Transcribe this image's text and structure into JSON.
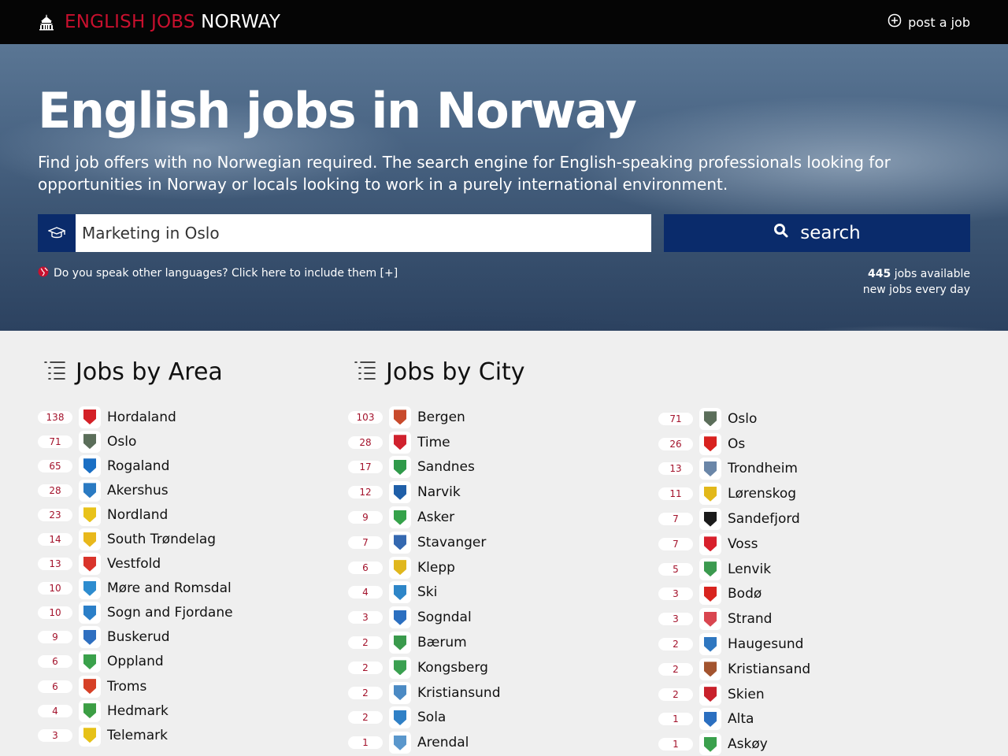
{
  "header": {
    "brand_part1": "ENGLISH JOBS",
    "brand_part2": "NORWAY",
    "post_job_label": "post a job"
  },
  "hero": {
    "title": "English jobs in Norway",
    "lead": "Find job offers with no Norwegian required. The search engine for English-speaking professionals looking for opportunities in Norway or locals looking to work in a purely international environment.",
    "search_value": "Marketing in Oslo",
    "search_button": "search",
    "languages_link": "Do you speak other languages? Click here to include them [+]",
    "jobs_count": "445",
    "jobs_available": "jobs available",
    "new_jobs": "new jobs every day"
  },
  "areas": {
    "title": "Jobs by Area",
    "items": [
      {
        "count": "138",
        "label": "Hordaland",
        "color": "#d42027"
      },
      {
        "count": "71",
        "label": "Oslo",
        "color": "#5b6e5a"
      },
      {
        "count": "65",
        "label": "Rogaland",
        "color": "#1a6fc4"
      },
      {
        "count": "28",
        "label": "Akershus",
        "color": "#2a7ac2"
      },
      {
        "count": "23",
        "label": "Nordland",
        "color": "#e8c21a"
      },
      {
        "count": "14",
        "label": "South Trøndelag",
        "color": "#e8b81c"
      },
      {
        "count": "13",
        "label": "Vestfold",
        "color": "#d9342b"
      },
      {
        "count": "10",
        "label": "Møre and Romsdal",
        "color": "#2d8ccf"
      },
      {
        "count": "10",
        "label": "Sogn and Fjordane",
        "color": "#2b7fc8"
      },
      {
        "count": "9",
        "label": "Buskerud",
        "color": "#2e6fc0"
      },
      {
        "count": "6",
        "label": "Oppland",
        "color": "#3aa14b"
      },
      {
        "count": "6",
        "label": "Troms",
        "color": "#d64027"
      },
      {
        "count": "4",
        "label": "Hedmark",
        "color": "#3c9e44"
      },
      {
        "count": "3",
        "label": "Telemark",
        "color": "#e6c117"
      }
    ]
  },
  "cities": {
    "title": "Jobs by City",
    "col1": [
      {
        "count": "103",
        "label": "Bergen",
        "color": "#c84a2c"
      },
      {
        "count": "28",
        "label": "Time",
        "color": "#d0222e"
      },
      {
        "count": "17",
        "label": "Sandnes",
        "color": "#2f9a4a"
      },
      {
        "count": "12",
        "label": "Narvik",
        "color": "#1f5fa8"
      },
      {
        "count": "9",
        "label": "Asker",
        "color": "#35a24a"
      },
      {
        "count": "7",
        "label": "Stavanger",
        "color": "#3468b0"
      },
      {
        "count": "6",
        "label": "Klepp",
        "color": "#e0b71d"
      },
      {
        "count": "4",
        "label": "Ski",
        "color": "#2e86c8"
      },
      {
        "count": "3",
        "label": "Sogndal",
        "color": "#2b6fc0"
      },
      {
        "count": "2",
        "label": "Bærum",
        "color": "#3a9a4c"
      },
      {
        "count": "2",
        "label": "Kongsberg",
        "color": "#3aa050"
      },
      {
        "count": "2",
        "label": "Kristiansund",
        "color": "#4b8ac4"
      },
      {
        "count": "2",
        "label": "Sola",
        "color": "#2f80c6"
      },
      {
        "count": "1",
        "label": "Arendal",
        "color": "#5a97cc"
      }
    ],
    "col2": [
      {
        "count": "71",
        "label": "Oslo",
        "color": "#5b6e5a"
      },
      {
        "count": "26",
        "label": "Os",
        "color": "#d8221f"
      },
      {
        "count": "13",
        "label": "Trondheim",
        "color": "#6a86a8"
      },
      {
        "count": "11",
        "label": "Lørenskog",
        "color": "#e2b81a"
      },
      {
        "count": "7",
        "label": "Sandefjord",
        "color": "#1b1b1b"
      },
      {
        "count": "7",
        "label": "Voss",
        "color": "#d8202c"
      },
      {
        "count": "5",
        "label": "Lenvik",
        "color": "#3b9a4f"
      },
      {
        "count": "3",
        "label": "Bodø",
        "color": "#d8241f"
      },
      {
        "count": "3",
        "label": "Strand",
        "color": "#d94650"
      },
      {
        "count": "2",
        "label": "Haugesund",
        "color": "#2f77c0"
      },
      {
        "count": "2",
        "label": "Kristiansand",
        "color": "#a3542f"
      },
      {
        "count": "2",
        "label": "Skien",
        "color": "#c8212b"
      },
      {
        "count": "1",
        "label": "Alta",
        "color": "#2b6fc0"
      },
      {
        "count": "1",
        "label": "Askøy",
        "color": "#3aa04c"
      }
    ]
  }
}
